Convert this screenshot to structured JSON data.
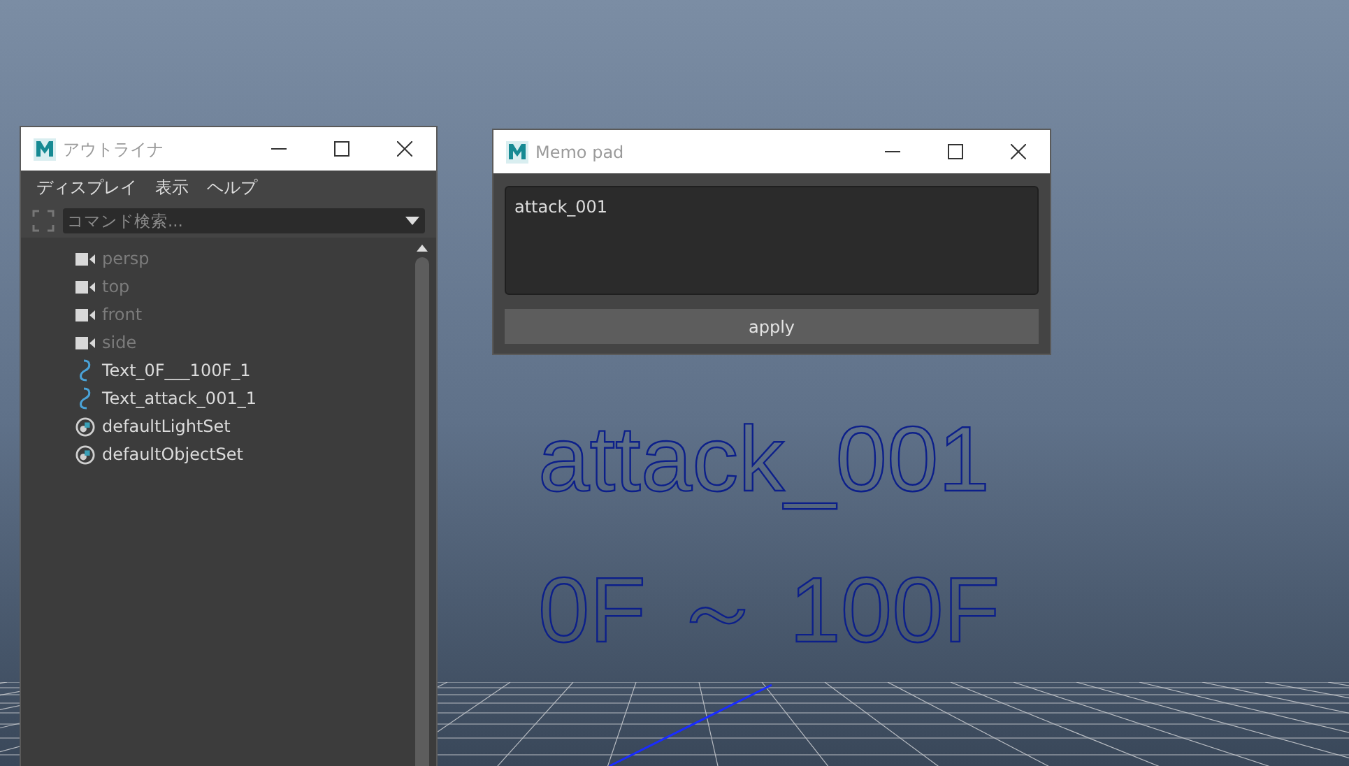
{
  "outliner": {
    "title": "アウトライナ",
    "menu": [
      "ディスプレイ",
      "表示",
      "ヘルプ"
    ],
    "search": {
      "placeholder": "コマンド検索..."
    },
    "items": [
      {
        "kind": "camera",
        "label": "persp",
        "hidden": true
      },
      {
        "kind": "camera",
        "label": "top",
        "hidden": true
      },
      {
        "kind": "camera",
        "label": "front",
        "hidden": true
      },
      {
        "kind": "camera",
        "label": "side",
        "hidden": true
      },
      {
        "kind": "curve",
        "label": "Text_0F___100F_1",
        "hidden": false
      },
      {
        "kind": "curve",
        "label": "Text_attack_001_1",
        "hidden": false
      },
      {
        "kind": "set",
        "label": "defaultLightSet",
        "hidden": false
      },
      {
        "kind": "set",
        "label": "defaultObjectSet",
        "hidden": false
      }
    ]
  },
  "memo": {
    "title": "Memo pad",
    "text": "attack_001",
    "button": "apply"
  },
  "viewport": {
    "texts": [
      "attack_001",
      "0F ～ 100F"
    ]
  }
}
